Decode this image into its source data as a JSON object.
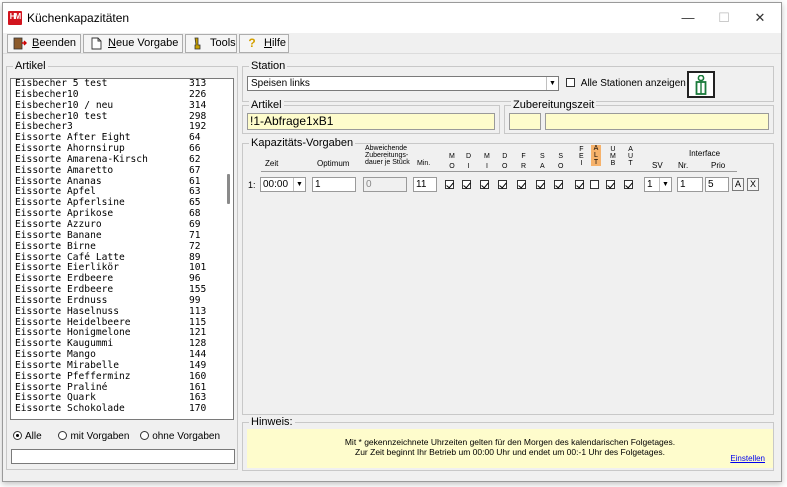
{
  "window": {
    "title": "Küchenkapazitäten",
    "minimize": "—",
    "maximize": "☐",
    "close": "✕"
  },
  "toolbar": {
    "exit": {
      "label": "Beenden",
      "underline": "B",
      "rest": "eenden"
    },
    "new_template": {
      "label": "Neue Vorgabe",
      "underline": "N",
      "rest": "eue Vorgabe"
    },
    "tools": {
      "label": "Tools"
    },
    "help": {
      "label": "Hilfe",
      "underline": "H",
      "rest": "ilfe"
    }
  },
  "articles": {
    "group_label": "Artikel",
    "items": [
      {
        "name": "Eisbecher 5 test",
        "num": "313"
      },
      {
        "name": "Eisbecher10",
        "num": "226"
      },
      {
        "name": "Eisbecher10 / neu",
        "num": "314"
      },
      {
        "name": "Eisbecher10 test",
        "num": "298"
      },
      {
        "name": "Eisbecher3",
        "num": "192"
      },
      {
        "name": "Eissorte After Eight",
        "num": "64"
      },
      {
        "name": "Eissorte Ahornsirup",
        "num": "66"
      },
      {
        "name": "Eissorte Amarena-Kirsch",
        "num": "62"
      },
      {
        "name": "Eissorte Amaretto",
        "num": "67"
      },
      {
        "name": "Eissorte Ananas",
        "num": "61"
      },
      {
        "name": "Eissorte Apfel",
        "num": "63"
      },
      {
        "name": "Eissorte Apferlsine",
        "num": "65"
      },
      {
        "name": "Eissorte Aprikose",
        "num": "68"
      },
      {
        "name": "Eissorte Azzuro",
        "num": "69"
      },
      {
        "name": "Eissorte Banane",
        "num": "71"
      },
      {
        "name": "Eissorte Birne",
        "num": "72"
      },
      {
        "name": "Eissorte Café Latte",
        "num": "89"
      },
      {
        "name": "Eissorte Eierlikör",
        "num": "101"
      },
      {
        "name": "Eissorte Erdbeere",
        "num": "96"
      },
      {
        "name": "Eissorte Erdbeere",
        "num": "155"
      },
      {
        "name": "Eissorte Erdnuss",
        "num": "99"
      },
      {
        "name": "Eissorte Haselnuss",
        "num": "113"
      },
      {
        "name": "Eissorte Heidelbeere",
        "num": "115"
      },
      {
        "name": "Eissorte Honigmelone",
        "num": "121"
      },
      {
        "name": "Eissorte Kaugummi",
        "num": "128"
      },
      {
        "name": "Eissorte Mango",
        "num": "144"
      },
      {
        "name": "Eissorte Mirabelle",
        "num": "149"
      },
      {
        "name": "Eissorte Pfefferminz",
        "num": "160"
      },
      {
        "name": "Eissorte Praliné",
        "num": "161"
      },
      {
        "name": "Eissorte Quark",
        "num": "163"
      },
      {
        "name": "Eissorte Schokolade",
        "num": "170"
      }
    ],
    "filter": {
      "all": "Alle",
      "with": "mit Vorgaben",
      "without": "ohne Vorgaben",
      "selected": "all"
    },
    "search_value": ""
  },
  "station": {
    "group_label": "Station",
    "selected": "Speisen links",
    "show_all_label": "Alle Stationen anzeigen",
    "show_all_checked": false
  },
  "article_detail": {
    "group_label": "Artikel",
    "value": "!1-Abfrage1xB1"
  },
  "prep_time": {
    "group_label": "Zubereitungszeit",
    "value1": "",
    "value2": ""
  },
  "capacity": {
    "group_label": "Kapazitäts-Vorgaben",
    "headers": {
      "time": "Zeit",
      "optimum": "Optimum",
      "deviating_1": "Abweichende",
      "deviating_2": "Zubereitungs-",
      "deviating_3": "dauer je Stück",
      "min": "Min.",
      "sv": "SV",
      "interface": "Interface",
      "nr": "Nr.",
      "prio": "Prio",
      "days": [
        {
          "l1": "M",
          "l2": "O"
        },
        {
          "l1": "D",
          "l2": "I"
        },
        {
          "l1": "M",
          "l2": "I"
        },
        {
          "l1": "D",
          "l2": "O"
        },
        {
          "l1": "F",
          "l2": "R"
        },
        {
          "l1": "S",
          "l2": "A"
        },
        {
          "l1": "S",
          "l2": "O"
        }
      ],
      "feit": {
        "l1": "F",
        "l2": "E",
        "l3": "I"
      },
      "alt": {
        "l1": "A",
        "l2": "L",
        "l3": "T"
      },
      "umb": {
        "l1": "U",
        "l2": "M",
        "l3": "B"
      },
      "aut": {
        "l1": "A",
        "l2": "U",
        "l3": "T"
      }
    },
    "row": {
      "index": "1:",
      "time": "00:00",
      "optimum": "1",
      "deviating": "0",
      "min": "11",
      "days_checked": [
        true,
        true,
        true,
        true,
        true,
        true,
        true
      ],
      "feit": true,
      "alt": false,
      "umb": true,
      "aut": true,
      "sv": "1",
      "nr": "1",
      "prio": "5",
      "btn_a": "A",
      "btn_x": "X"
    }
  },
  "hint": {
    "group_label": "Hinweis:",
    "line1": "Mit * gekennzeichnete Uhrzeiten gelten für den Morgen des kalendarischen Folgetages.",
    "line2": "Zur Zeit beginnt Ihr Betrieb um 00:00 Uhr und endet um 00:-1 Uhr des Folgetages.",
    "link": "Einstellen"
  },
  "colors": {
    "field_yellow": "#fefccc",
    "accent_orange": "#f6b26b",
    "app_red": "#d2141e"
  },
  "icons": {
    "station_icon": "person-station-icon"
  }
}
